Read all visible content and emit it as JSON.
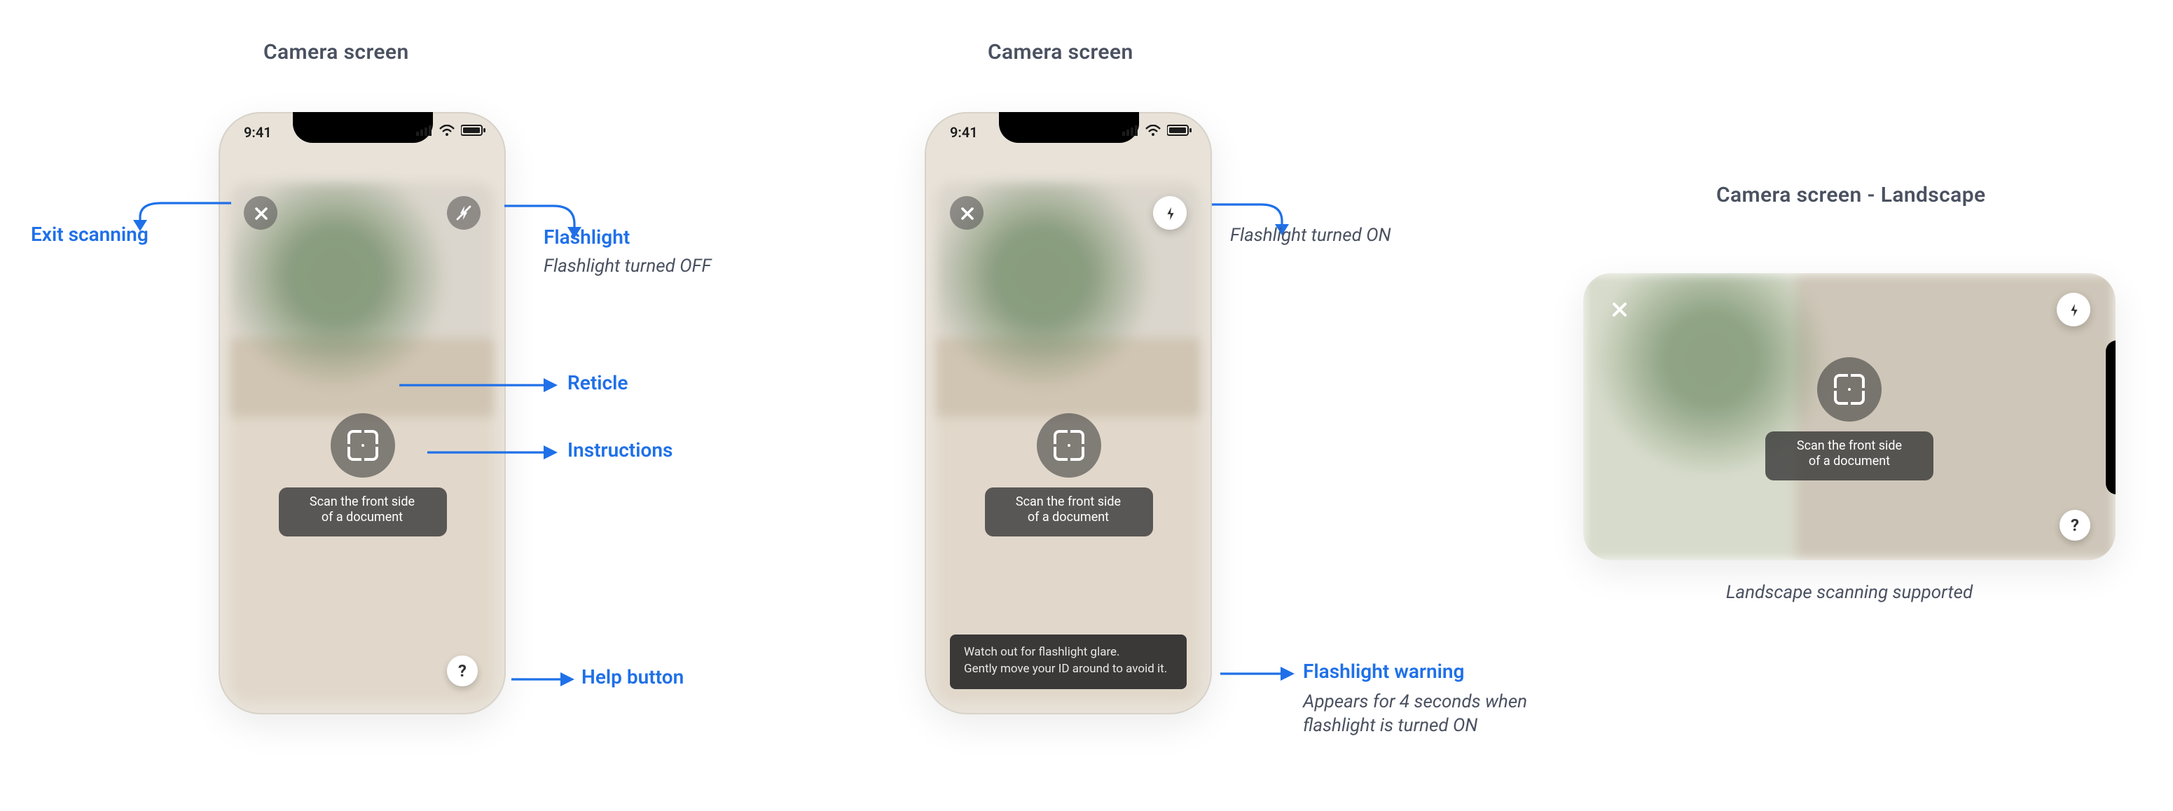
{
  "statusbar": {
    "time": "9:41"
  },
  "instruction_l1": "Scan the front side",
  "instruction_l2": "of a document",
  "toast_l1": "Watch out for flashlight glare.",
  "toast_l2": "Gently move your ID around to avoid it.",
  "panel1": {
    "title": "Camera screen",
    "callouts": {
      "exit": "Exit scanning",
      "flashlight": "Flashlight",
      "flashlight_sub": "Flashlight turned OFF",
      "reticle": "Reticle",
      "instructions": "Instructions",
      "help": "Help button"
    }
  },
  "panel2": {
    "title": "Camera screen",
    "callouts": {
      "flash_on": "Flashlight turned ON",
      "warning": "Flashlight warning",
      "warning_sub1": "Appears for 4 seconds when",
      "warning_sub2": "flashlight is turned ON"
    }
  },
  "panel3": {
    "title": "Camera screen - Landscape",
    "caption": "Landscape scanning supported"
  },
  "icons": {
    "help_glyph": "?"
  }
}
